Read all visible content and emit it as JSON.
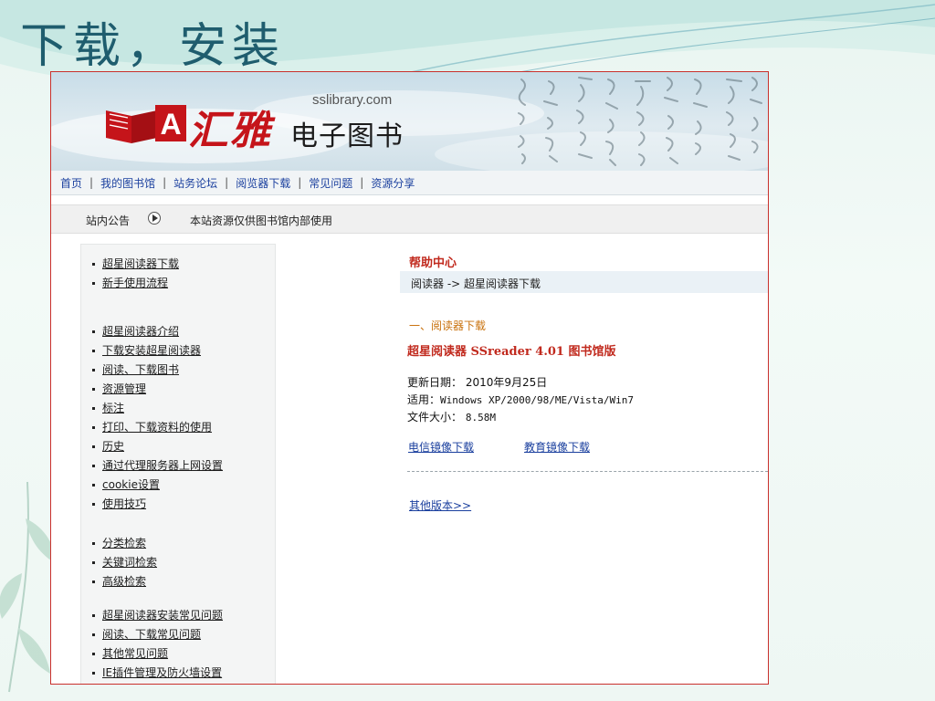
{
  "slide": {
    "title": "下载，安装"
  },
  "site": {
    "logo_text": "汇雅",
    "logo_sub": "电子图书",
    "url": "sslibrary.com"
  },
  "nav": {
    "items": [
      "首页",
      "我的图书馆",
      "站务论坛",
      "阅览器下载",
      "常见问题",
      "资源分享"
    ]
  },
  "notice": {
    "label": "站内公告",
    "text": "本站资源仅供图书馆内部使用"
  },
  "sidebar": {
    "groups": [
      [
        "超星阅读器下载",
        "新手使用流程"
      ],
      [
        "超星阅读器介绍",
        "下载安装超星阅读器",
        "阅读、下载图书",
        "资源管理",
        "标注",
        "打印、下载资料的使用",
        "历史",
        "通过代理服务器上网设置",
        "cookie设置",
        "使用技巧"
      ],
      [
        "分类检索",
        "关键词检索",
        "高级检索"
      ],
      [
        "超星阅读器安装常见问题",
        "阅读、下载常见问题",
        "其他常见问题",
        "IE插件管理及防火墙设置"
      ]
    ]
  },
  "main": {
    "help_title": "帮助中心",
    "breadcrumb": "阅读器 -> 超星阅读器下载",
    "section_title": "一、阅读器下载",
    "product_title": "超星阅读器 SSreader 4.01 图书馆版",
    "update_label": "更新日期：",
    "update_value": "2010年9月25日",
    "platform_label": "适用：",
    "platform_value": "Windows XP/2000/98/ME/Vista/Win7",
    "size_label": "文件大小：",
    "size_value": "8.58M",
    "telecom_link": "电信镜像下载",
    "edu_link": "教育镜像下载",
    "other_versions": "其他版本>>"
  },
  "colors": {
    "accent_red": "#c12a1e",
    "link_blue": "#1a3f9e",
    "section_orange": "#c9720e",
    "title_teal": "#1f5d6e"
  }
}
